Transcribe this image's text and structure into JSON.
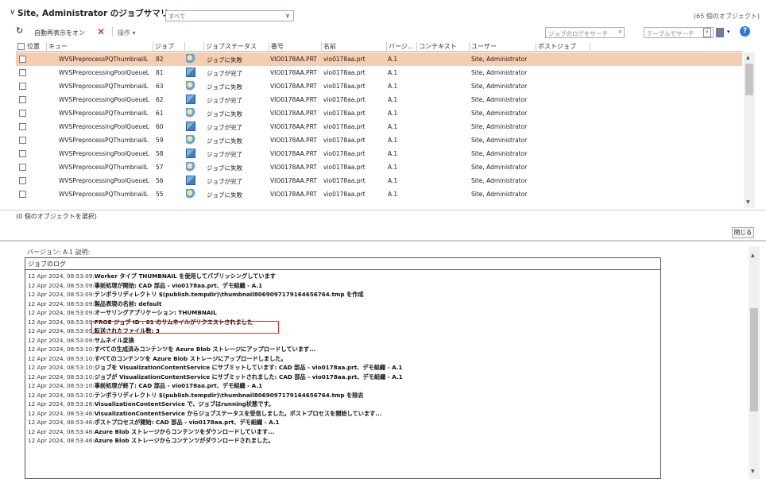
{
  "header": {
    "title": "Site, Administrator のジョブサマリー",
    "filter_value": "すべて",
    "object_count": "(65 個のオブジェクト)"
  },
  "toolbar": {
    "auto_refresh_label": "自動再表示をオン",
    "operations_label": "操作 ▾",
    "search_log_placeholder": "ジョブのログをサーチ",
    "search_table_placeholder": "テーブルでサーチ"
  },
  "table": {
    "columns": [
      "位置",
      "キュー",
      "ジョブ",
      "",
      "ジョブステータス",
      "番号",
      "名前",
      "バージ...",
      "コンテキスト",
      "ユーザー",
      "ポストジョブ"
    ],
    "rows": [
      {
        "queue": "WVSPreprocessPQThumbnailL",
        "job": "82",
        "status": "ジョブに失敗",
        "status_icon": "fail",
        "number": "VIO0178AA.PRT",
        "name": "vio0178aa.prt",
        "version": "A.1",
        "context": "",
        "user": "Site, Administrator",
        "post_job": ""
      },
      {
        "queue": "WVSPreprocessingPoolQueueL",
        "job": "81",
        "status": "ジョブが完了",
        "status_icon": "done",
        "number": "VIO0178AA.PRT",
        "name": "vio0178aa.prt",
        "version": "A.1",
        "context": "",
        "user": "Site, Administrator",
        "post_job": ""
      },
      {
        "queue": "WVSPreprocessPQThumbnailL",
        "job": "63",
        "status": "ジョブに失敗",
        "status_icon": "fail",
        "number": "VIO0178AA.PRT",
        "name": "vio0178aa.prt",
        "version": "A.1",
        "context": "",
        "user": "Site, Administrator",
        "post_job": ""
      },
      {
        "queue": "WVSPreprocessingPoolQueueL",
        "job": "62",
        "status": "ジョブが完了",
        "status_icon": "done",
        "number": "VIO0178AA.PRT",
        "name": "vio0178aa.prt",
        "version": "A.1",
        "context": "",
        "user": "Site, Administrator",
        "post_job": ""
      },
      {
        "queue": "WVSPreprocessPQThumbnailL",
        "job": "61",
        "status": "ジョブに失敗",
        "status_icon": "fail",
        "number": "VIO0178AA.PRT",
        "name": "vio0178aa.prt",
        "version": "A.1",
        "context": "",
        "user": "Site, Administrator",
        "post_job": ""
      },
      {
        "queue": "WVSPreprocessingPoolQueueL",
        "job": "60",
        "status": "ジョブが完了",
        "status_icon": "done",
        "number": "VIO0178AA.PRT",
        "name": "vio0178aa.prt",
        "version": "A.1",
        "context": "",
        "user": "Site, Administrator",
        "post_job": ""
      },
      {
        "queue": "WVSPreprocessPQThumbnailL",
        "job": "59",
        "status": "ジョブに失敗",
        "status_icon": "fail",
        "number": "VIO0178AA.PRT",
        "name": "vio0178aa.prt",
        "version": "A.1",
        "context": "",
        "user": "Site, Administrator",
        "post_job": ""
      },
      {
        "queue": "WVSPreprocessingPoolQueueL",
        "job": "58",
        "status": "ジョブが完了",
        "status_icon": "done",
        "number": "VIO0178AA.PRT",
        "name": "vio0178aa.prt",
        "version": "A.1",
        "context": "",
        "user": "Site, Administrator",
        "post_job": ""
      },
      {
        "queue": "WVSPreprocessPQThumbnailL",
        "job": "57",
        "status": "ジョブに失敗",
        "status_icon": "fail",
        "number": "VIO0178AA.PRT",
        "name": "vio0178aa.prt",
        "version": "A.1",
        "context": "",
        "user": "Site, Administrator",
        "post_job": ""
      },
      {
        "queue": "WVSPreprocessingPoolQueueL",
        "job": "56",
        "status": "ジョブが完了",
        "status_icon": "done",
        "number": "VIO0178AA.PRT",
        "name": "vio0178aa.prt",
        "version": "A.1",
        "context": "",
        "user": "Site, Administrator",
        "post_job": ""
      },
      {
        "queue": "WVSPreprocessPQThumbnailL",
        "job": "55",
        "status": "ジョブに失敗",
        "status_icon": "fail",
        "number": "VIO0178AA.PRT",
        "name": "vio0178aa.prt",
        "version": "A.1",
        "context": "",
        "user": "Site, Administrator",
        "post_job": ""
      }
    ],
    "selected_count": "(0 個のオブジェクトを選択)"
  },
  "actions": {
    "close_label": "閉じる"
  },
  "details": {
    "partial_line": "バージョン:     A.1                                         説明:"
  },
  "log": {
    "title": "ジョブのログ",
    "lines": [
      {
        "ts": "12 Apr 2024, 08:53:09:",
        "text": "Worker タイプ THUMBNAIL を使用してパブリッシングしています"
      },
      {
        "ts": "12 Apr 2024, 08:53:09:",
        "text": "事前処理が開始: CAD 部品 - vio0178aa.prt、デモ組織 - A.1"
      },
      {
        "ts": "12 Apr 2024, 08:53:09:",
        "text": "テンポラリディレクトリ $(publish.tempdir)\\thumbnail8069097179164656764.tmp を作成"
      },
      {
        "ts": "12 Apr 2024, 08:53:09:",
        "text": "製品表現の名前: default"
      },
      {
        "ts": "12 Apr 2024, 08:53:09:",
        "text": "オーサリングアプリケーション: THUMBNAIL"
      },
      {
        "ts": "12 Apr 2024, 08:53:09:",
        "text": "PROE ジョブ ID : 81 のサムネイルがリクエストされました"
      },
      {
        "ts": "12 Apr 2024, 08:53:09:",
        "text": "転送されたファイル数: 3"
      },
      {
        "ts": "12 Apr 2024, 08:53:09:",
        "text": "サムネイル変換"
      },
      {
        "ts": "12 Apr 2024, 08:53:10:",
        "text": "すべての生成済みコンテンツを Azure Blob ストレージにアップロードしています..."
      },
      {
        "ts": "12 Apr 2024, 08:53:10:",
        "text": "すべてのコンテンツを Azure Blob ストレージにアップロードしました。"
      },
      {
        "ts": "12 Apr 2024, 08:53:10:",
        "text": "ジョブを VisualizationContentService にサブミットしています: CAD 部品 - vio0178aa.prt、デモ組織 - A.1"
      },
      {
        "ts": "12 Apr 2024, 08:53:10:",
        "text": "ジョブが VisualizationContentService にサブミットされました: CAD 部品 - vio0178aa.prt、デモ組織 - A.1"
      },
      {
        "ts": "12 Apr 2024, 08:53:10:",
        "text": "事前処理が終了: CAD 部品 - vio0178aa.prt、デモ組織 - A.1"
      },
      {
        "ts": "12 Apr 2024, 08:53:10:",
        "text": "テンポラリディレクトリ $(publish.tempdir)\\thumbnail8069097179164656764.tmp を除去"
      },
      {
        "ts": "12 Apr 2024, 08:53:26:",
        "text": "VisualizationContentService で、ジョブはrunning状態です。"
      },
      {
        "ts": "12 Apr 2024, 08:53:46:",
        "text": "VisualizationContentService からジョブステータスを受信しました。ポストプロセスを開始しています..."
      },
      {
        "ts": "12 Apr 2024, 08:53:46:",
        "text": "ポストプロセスが開始: CAD 部品 - vio0178aa.prt、デモ組織 - A.1"
      },
      {
        "ts": "12 Apr 2024, 08:53:46:",
        "text": "Azure Blob ストレージからコンテンツをダウンロードしています..."
      },
      {
        "ts": "12 Apr 2024, 08:53:46:",
        "text": "Azure Blob ストレージからコンテンツがダウンロードされました。"
      }
    ]
  },
  "colors": {
    "selected_row": "#f5cdb0",
    "highlight_border": "#e0312b",
    "accent_blue": "#2b7bd3"
  }
}
